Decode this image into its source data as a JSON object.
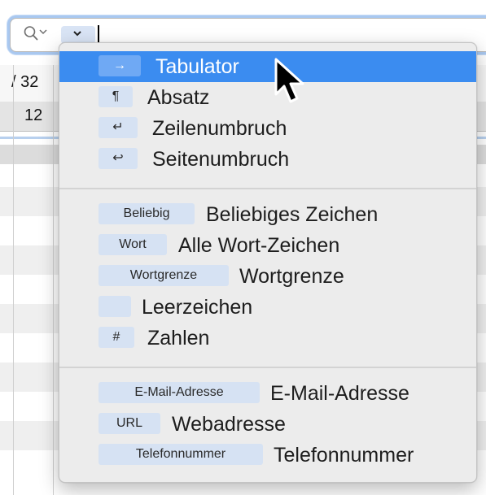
{
  "search": {
    "token_chevron": "⌄"
  },
  "sheet": {
    "cells": {
      "row1_col1": "/ 32",
      "row2_col1": "12"
    }
  },
  "menu": {
    "groups": [
      [
        {
          "chip": "→",
          "label": "Tabulator",
          "selected": true
        },
        {
          "chip": "¶",
          "label": "Absatz"
        },
        {
          "chip": "↵",
          "label": "Zeilenumbruch"
        },
        {
          "chip": "↩",
          "label": "Seitenumbruch"
        }
      ],
      [
        {
          "chip": "Beliebig",
          "label": "Beliebiges Zeichen"
        },
        {
          "chip": "Wort",
          "label": "Alle Wort-Zeichen"
        },
        {
          "chip": "Wortgrenze",
          "label": "Wortgrenze"
        },
        {
          "chip": "",
          "label": "Leerzeichen"
        },
        {
          "chip": "#",
          "label": "Zahlen"
        }
      ],
      [
        {
          "chip": "E-Mail-Adresse",
          "label": "E-Mail-Adresse"
        },
        {
          "chip": "URL",
          "label": "Webadresse"
        },
        {
          "chip": "Telefonnummer",
          "label": "Telefonnummer"
        }
      ]
    ]
  },
  "colors": {
    "selection": "#3b8cf0",
    "chip": "#d6e2f3",
    "menu_bg": "#ececec"
  }
}
